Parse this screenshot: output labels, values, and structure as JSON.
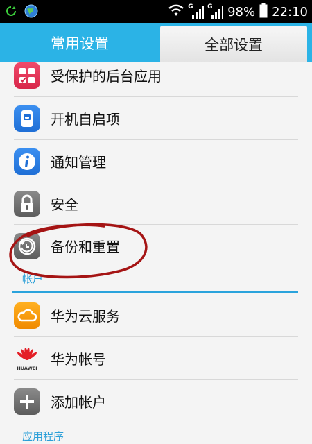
{
  "status_bar": {
    "battery": "98%",
    "time": "22:10",
    "network_1": "G",
    "network_2": "G"
  },
  "tabs": [
    {
      "label": "常用设置",
      "active": false
    },
    {
      "label": "全部设置",
      "active": true
    }
  ],
  "rows": [
    {
      "label": "受保护的后台应用",
      "icon": "protected-apps-icon"
    },
    {
      "label": "开机自启项",
      "icon": "startup-apps-icon"
    },
    {
      "label": "通知管理",
      "icon": "info-icon"
    },
    {
      "label": "安全",
      "icon": "lock-icon"
    },
    {
      "label": "备份和重置",
      "icon": "backup-restore-icon"
    }
  ],
  "sections": {
    "accounts": "帐户",
    "apps": "应用程序"
  },
  "account_rows": [
    {
      "label": "华为云服务",
      "icon": "cloud-icon"
    },
    {
      "label": "华为帐号",
      "icon": "huawei-logo-icon"
    },
    {
      "label": "添加帐户",
      "icon": "add-icon"
    }
  ],
  "logo_text": "HUAWEI",
  "colors": {
    "tab_bar": "#2bb3e6",
    "accent": "#2a9fd8",
    "annotation": "#b01818"
  }
}
